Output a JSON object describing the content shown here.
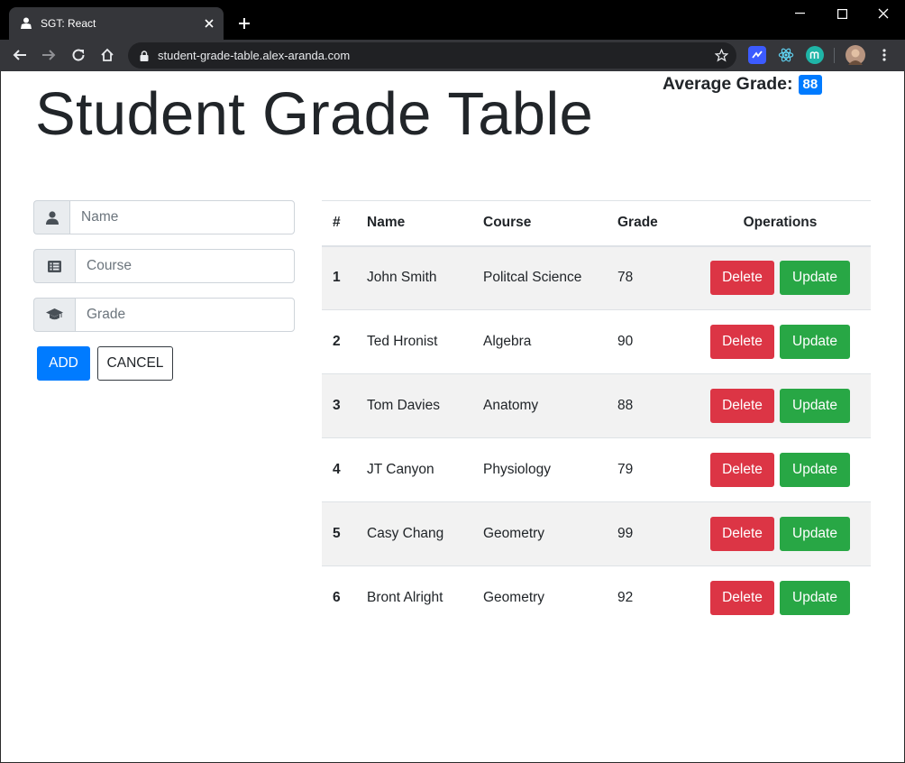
{
  "browser": {
    "tab_title": "SGT: React",
    "url": "student-grade-table.alex-aranda.com"
  },
  "page": {
    "title": "Student Grade Table",
    "average_label": "Average Grade:",
    "average_value": "88"
  },
  "form": {
    "name_placeholder": "Name",
    "course_placeholder": "Course",
    "grade_placeholder": "Grade",
    "add_label": "ADD",
    "cancel_label": "CANCEL"
  },
  "table": {
    "headers": {
      "num": "#",
      "name": "Name",
      "course": "Course",
      "grade": "Grade",
      "operations": "Operations"
    },
    "delete_label": "Delete",
    "update_label": "Update",
    "rows": [
      {
        "num": "1",
        "name": "John Smith",
        "course": "Politcal Science",
        "grade": "78"
      },
      {
        "num": "2",
        "name": "Ted Hronist",
        "course": "Algebra",
        "grade": "90"
      },
      {
        "num": "3",
        "name": "Tom Davies",
        "course": "Anatomy",
        "grade": "88"
      },
      {
        "num": "4",
        "name": "JT Canyon",
        "course": "Physiology",
        "grade": "79"
      },
      {
        "num": "5",
        "name": "Casy Chang",
        "course": "Geometry",
        "grade": "99"
      },
      {
        "num": "6",
        "name": "Bront Alright",
        "course": "Geometry",
        "grade": "92"
      }
    ]
  },
  "colors": {
    "primary": "#007bff",
    "danger": "#dc3545",
    "success": "#28a745",
    "chrome_dark": "#35363a"
  }
}
